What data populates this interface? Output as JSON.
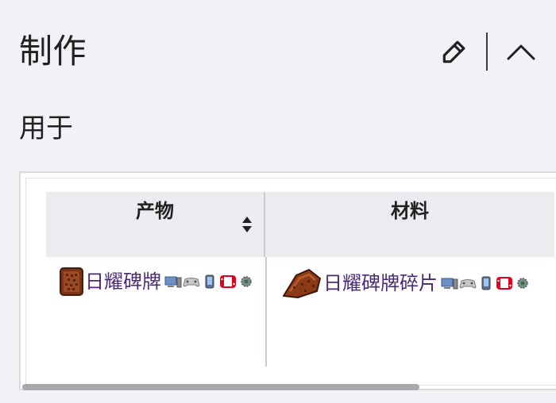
{
  "section": {
    "title": "制作",
    "edit_icon": "pencil-icon",
    "collapse_icon": "chevron-up-icon"
  },
  "subsection": {
    "title": "用于"
  },
  "table": {
    "columns": [
      {
        "label": "产物",
        "sortable": true
      },
      {
        "label": "材料",
        "sortable": false
      }
    ],
    "rows": [
      {
        "product": {
          "name": "日耀碑牌",
          "icon": "sunplate-tablet-icon",
          "platforms": [
            "pc-icon",
            "console-icon",
            "mobile-icon",
            "switch-icon",
            "tmodloader-icon"
          ]
        },
        "materials": [
          {
            "name": "日耀碑牌碎片",
            "icon": "sunplate-fragment-icon",
            "platforms": [
              "pc-icon",
              "console-icon",
              "mobile-icon",
              "switch-icon",
              "tmodloader-icon"
            ]
          }
        ]
      }
    ]
  },
  "colors": {
    "page_bg": "#f3f1f5",
    "header_bg": "#eaecf0",
    "link": "#4b2a73",
    "border": "#c8ccd1",
    "scroll_thumb": "#a8a9ab"
  }
}
